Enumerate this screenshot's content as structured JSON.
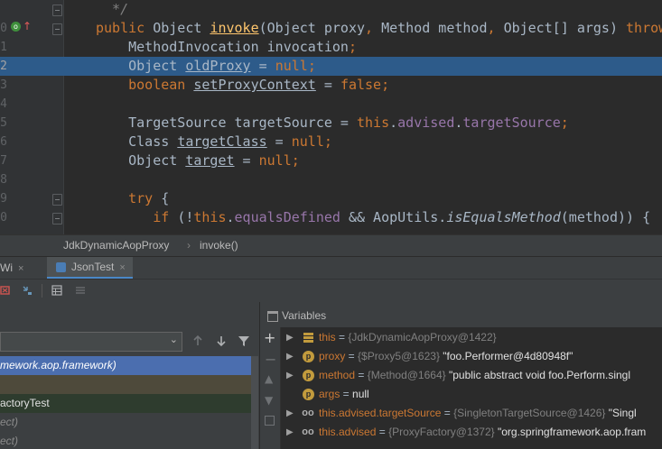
{
  "editor": {
    "line_numbers": [
      "",
      "0",
      "1",
      "2",
      "3",
      "4",
      "5",
      "6",
      "7",
      "8",
      "9",
      "0"
    ],
    "lines": [
      {
        "parts": [
          {
            "t": "  */",
            "c": "cmt"
          }
        ]
      },
      {
        "parts": [
          {
            "t": "public ",
            "c": "kw"
          },
          {
            "t": "Object ",
            "c": ""
          },
          {
            "t": "invoke",
            "c": "fn under"
          },
          {
            "t": "(Object proxy",
            "c": ""
          },
          {
            "t": ", ",
            "c": "kw"
          },
          {
            "t": "Method method",
            "c": ""
          },
          {
            "t": ", ",
            "c": "kw"
          },
          {
            "t": "Object[] args) ",
            "c": ""
          },
          {
            "t": "throw",
            "c": "kw"
          }
        ]
      },
      {
        "parts": [
          {
            "t": "    MethodInvocation invocation",
            "c": ""
          },
          {
            "t": ";",
            "c": "kw"
          }
        ]
      },
      {
        "parts": [
          {
            "t": "    Object ",
            "c": ""
          },
          {
            "t": "oldProxy",
            "c": "under"
          },
          {
            "t": " = ",
            "c": ""
          },
          {
            "t": "null",
            "c": "kw"
          },
          {
            "t": ";",
            "c": "kw"
          }
        ]
      },
      {
        "parts": [
          {
            "t": "    ",
            "c": ""
          },
          {
            "t": "boolean ",
            "c": "kw"
          },
          {
            "t": "setProxyContext",
            "c": "under"
          },
          {
            "t": " = ",
            "c": ""
          },
          {
            "t": "false",
            "c": "kw"
          },
          {
            "t": ";",
            "c": "kw"
          }
        ]
      },
      {
        "parts": [
          {
            "t": "",
            "c": ""
          }
        ]
      },
      {
        "parts": [
          {
            "t": "    TargetSource targetSource = ",
            "c": ""
          },
          {
            "t": "this",
            "c": "kw"
          },
          {
            "t": ".",
            "c": ""
          },
          {
            "t": "advised",
            "c": "fld"
          },
          {
            "t": ".",
            "c": ""
          },
          {
            "t": "targetSource",
            "c": "fld"
          },
          {
            "t": ";",
            "c": "kw"
          }
        ]
      },
      {
        "parts": [
          {
            "t": "    Class ",
            "c": ""
          },
          {
            "t": "targetClass",
            "c": "under"
          },
          {
            "t": " = ",
            "c": ""
          },
          {
            "t": "null",
            "c": "kw"
          },
          {
            "t": ";",
            "c": "kw"
          }
        ]
      },
      {
        "parts": [
          {
            "t": "    Object ",
            "c": ""
          },
          {
            "t": "target",
            "c": "under"
          },
          {
            "t": " = ",
            "c": ""
          },
          {
            "t": "null",
            "c": "kw"
          },
          {
            "t": ";",
            "c": "kw"
          }
        ]
      },
      {
        "parts": [
          {
            "t": "",
            "c": ""
          }
        ]
      },
      {
        "parts": [
          {
            "t": "    ",
            "c": ""
          },
          {
            "t": "try ",
            "c": "kw"
          },
          {
            "t": "{",
            "c": ""
          }
        ]
      },
      {
        "parts": [
          {
            "t": "       ",
            "c": ""
          },
          {
            "t": "if ",
            "c": "kw"
          },
          {
            "t": "(!",
            "c": ""
          },
          {
            "t": "this",
            "c": "kw"
          },
          {
            "t": ".",
            "c": ""
          },
          {
            "t": "equalsDefined",
            "c": "fld"
          },
          {
            "t": " && AopUtils.",
            "c": ""
          },
          {
            "t": "isEqualsMethod",
            "c": "italic"
          },
          {
            "t": "(method)) {",
            "c": ""
          }
        ]
      }
    ],
    "selected_line": 3
  },
  "breadcrumb": {
    "class_name": "JdkDynamicAopProxy",
    "separator": "›",
    "method_name": "invoke()"
  },
  "tabs": {
    "first_partial": "Wi",
    "second": "JsonTest",
    "close_glyph": "×"
  },
  "frames": {
    "select_value": "",
    "rows": [
      {
        "text": "mework.aop.framework)",
        "style": "selected"
      },
      {
        "text": "",
        "style": "olive"
      },
      {
        "text": "actoryTest",
        "style": "green"
      },
      {
        "text": "ect)",
        "style": "dim"
      },
      {
        "text": "ect)",
        "style": "dim"
      }
    ]
  },
  "variables": {
    "title": "Variables",
    "rows": [
      {
        "icon": "list",
        "name": "this",
        "eq": " = ",
        "ref": "{JdkDynamicAopProxy@1422}",
        "val": ""
      },
      {
        "icon": "p",
        "name": "proxy",
        "eq": " = ",
        "ref": "{$Proxy5@1623}",
        "val": " \"foo.Performer@4d80948f\""
      },
      {
        "icon": "p",
        "name": "method",
        "eq": " = ",
        "ref": "{Method@1664}",
        "val": " \"public abstract void foo.Perform.singl"
      },
      {
        "icon": "p",
        "name": "args",
        "eq": " = ",
        "ref": "",
        "val": "null"
      },
      {
        "icon": "oo",
        "name": "this.advised.targetSource",
        "eq": " = ",
        "ref": "{SingletonTargetSource@1426}",
        "val": " \"Singl"
      },
      {
        "icon": "oo",
        "name": "this.advised",
        "eq": " = ",
        "ref": "{ProxyFactory@1372}",
        "val": " \"org.springframework.aop.fram"
      }
    ]
  },
  "colors": {
    "selection": "#2d5b8a",
    "keyword": "#cc7832",
    "field": "#9876aa",
    "frame_selected": "#4b6eaf"
  }
}
